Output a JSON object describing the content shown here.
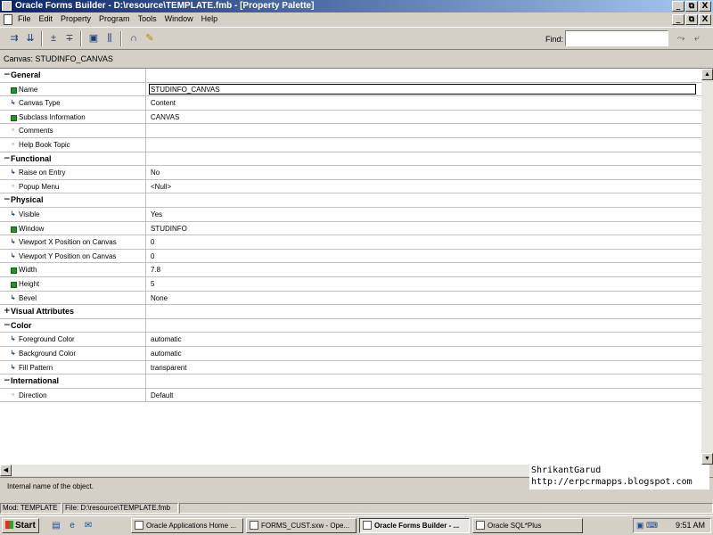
{
  "window": {
    "title": "Oracle Forms Builder - D:\\resource\\TEMPLATE.fmb - [Property Palette]",
    "controls": [
      "_",
      "⧉",
      "X"
    ]
  },
  "menu": [
    "File",
    "Edit",
    "Property",
    "Program",
    "Tools",
    "Window",
    "Help"
  ],
  "find": {
    "label": "Find:",
    "value": ""
  },
  "palette": {
    "context_label": "Canvas: STUDINFO_CANVAS",
    "rows": [
      {
        "type": "category",
        "state": "expanded",
        "expander": "−",
        "label": "General"
      },
      {
        "type": "property",
        "bullet": "square",
        "icon": "▪",
        "label": "Name",
        "value": "STUDINFO_CANVAS",
        "selected": true
      },
      {
        "type": "property",
        "bullet": "arrow",
        "icon": "↳",
        "label": "Canvas Type",
        "value": "Content"
      },
      {
        "type": "property",
        "bullet": "square",
        "icon": "▪",
        "label": "Subclass Information",
        "value": "CANVAS"
      },
      {
        "type": "property",
        "bullet": "dot",
        "icon": "○",
        "label": "Comments",
        "value": ""
      },
      {
        "type": "property",
        "bullet": "dot",
        "icon": "○",
        "label": "Help Book Topic",
        "value": ""
      },
      {
        "type": "category",
        "state": "expanded",
        "expander": "−",
        "label": "Functional"
      },
      {
        "type": "property",
        "bullet": "arrow",
        "icon": "↳",
        "label": "Raise on Entry",
        "value": "No"
      },
      {
        "type": "property",
        "bullet": "dot",
        "icon": "○",
        "label": "Popup Menu",
        "value": "<Null>"
      },
      {
        "type": "category",
        "state": "expanded",
        "expander": "−",
        "label": "Physical"
      },
      {
        "type": "property",
        "bullet": "arrow",
        "icon": "↳",
        "label": "Visible",
        "value": "Yes"
      },
      {
        "type": "property",
        "bullet": "square",
        "icon": "▪",
        "label": "Window",
        "value": "STUDINFO"
      },
      {
        "type": "property",
        "bullet": "arrow",
        "icon": "↳",
        "label": "Viewport X Position on Canvas",
        "value": "0"
      },
      {
        "type": "property",
        "bullet": "arrow",
        "icon": "↳",
        "label": "Viewport Y Position on Canvas",
        "value": "0"
      },
      {
        "type": "property",
        "bullet": "square",
        "icon": "▪",
        "label": "Width",
        "value": "7.8"
      },
      {
        "type": "property",
        "bullet": "square",
        "icon": "▪",
        "label": "Height",
        "value": "5"
      },
      {
        "type": "property",
        "bullet": "arrow",
        "icon": "↳",
        "label": "Bevel",
        "value": "None"
      },
      {
        "type": "category",
        "state": "collapsed",
        "expander": "+",
        "label": "Visual Attributes"
      },
      {
        "type": "category",
        "state": "expanded",
        "expander": "−",
        "label": "Color"
      },
      {
        "type": "property",
        "bullet": "arrow",
        "icon": "↳",
        "label": "Foreground Color",
        "value": "automatic"
      },
      {
        "type": "property",
        "bullet": "arrow",
        "icon": "↳",
        "label": "Background Color",
        "value": "automatic"
      },
      {
        "type": "property",
        "bullet": "arrow",
        "icon": "↳",
        "label": "Fill Pattern",
        "value": "transparent"
      },
      {
        "type": "category",
        "state": "expanded",
        "expander": "−",
        "label": "International"
      },
      {
        "type": "property",
        "bullet": "dot",
        "icon": "○",
        "label": "Direction",
        "value": "Default"
      }
    ]
  },
  "hint": "Internal name of the object.",
  "watermark": {
    "line1": "ShrikantGarud",
    "line2": "http://erpcrmapps.blogspot.com"
  },
  "status": {
    "mod": "Mod: TEMPLATE",
    "file": "File: D:\\resource\\TEMPLATE.fmb"
  },
  "taskbar": {
    "start_label": "Start",
    "tasks": [
      {
        "label": "Oracle Applications Home ...",
        "active": false
      },
      {
        "label": "FORMS_CUST.sxw - Ope...",
        "active": false
      },
      {
        "label": "Oracle Forms Builder - ...",
        "active": true
      },
      {
        "label": "Oracle SQL*Plus",
        "active": false
      }
    ],
    "clock": "9:51 AM"
  },
  "colors": {
    "titlebar_start": "#0a246a",
    "titlebar_end": "#a6caf0",
    "chrome": "#d4d0c8",
    "grid_line": "#c0c0c0"
  }
}
